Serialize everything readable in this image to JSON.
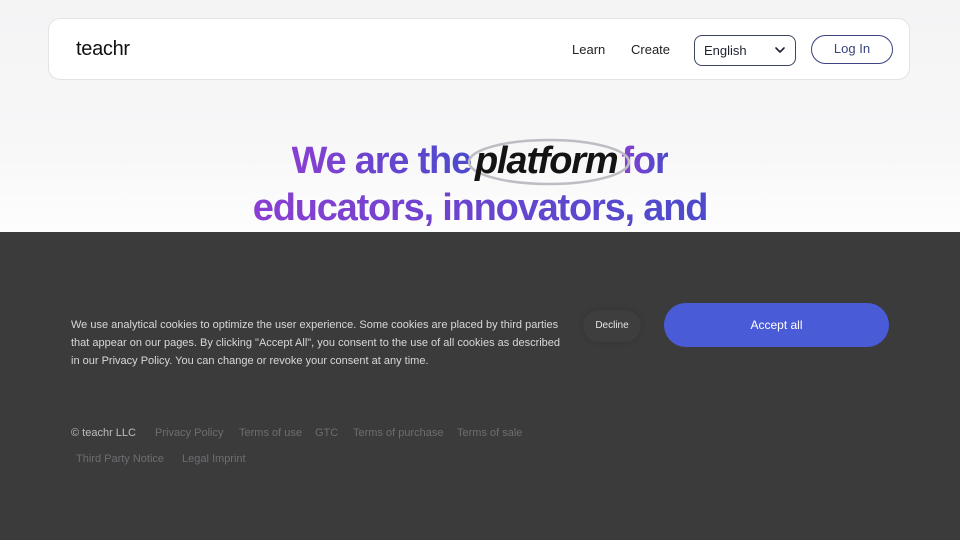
{
  "header": {
    "logo": "teachr",
    "nav": [
      {
        "label": "Learn"
      },
      {
        "label": "Create"
      }
    ],
    "language": {
      "selected": "English"
    },
    "login_label": "Log In"
  },
  "hero": {
    "line1_before": "We are the",
    "line1_highlight": "platform",
    "line1_after": "for",
    "line2": "educators, innovators, and"
  },
  "cookie_banner": {
    "text": "We use analytical cookies to optimize the user experience. Some cookies are placed by third parties that appear on our pages. By clicking \"Accept All\", you consent to the use of all cookies as described in our Privacy Policy. You can change or revoke your consent at any time.",
    "decline_label": "Decline",
    "accept_label": "Accept all",
    "accept_color": "#4a5bd8"
  },
  "footer": {
    "copyright": "© teachr LLC",
    "links": [
      "Privacy Policy",
      "Terms of use",
      "GTC",
      "Terms of purchase",
      "Terms of sale",
      "Third Party Notice",
      "Legal Imprint"
    ]
  },
  "colors": {
    "headline_gradient_start": "#8a3fd1",
    "headline_gradient_end": "#4c4bcc",
    "overlay": "#3b3b3c"
  }
}
